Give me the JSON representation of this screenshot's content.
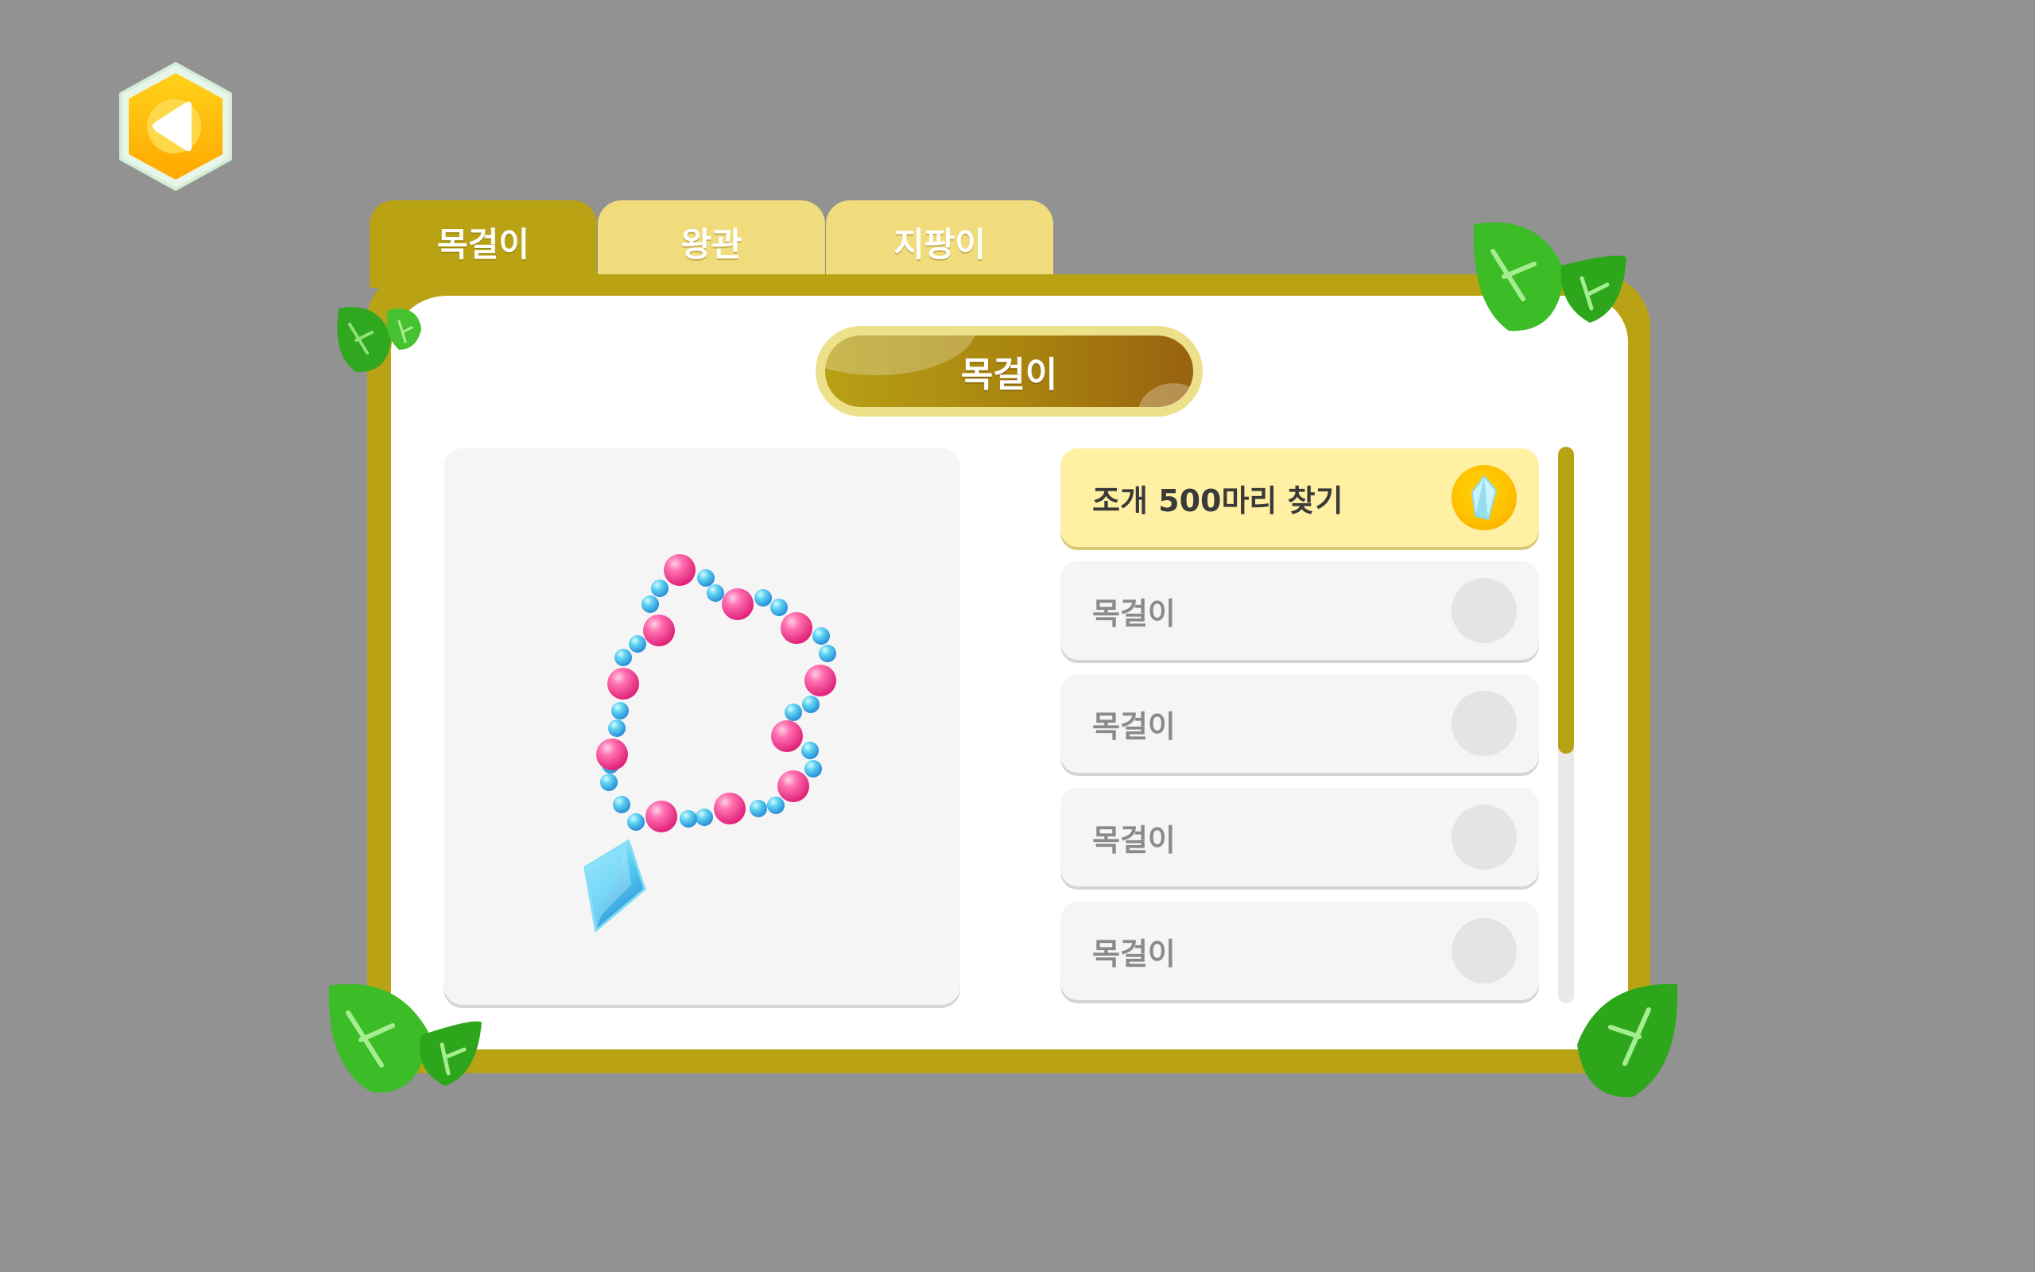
{
  "tabs": [
    {
      "label": "목걸이",
      "active": true
    },
    {
      "label": "왕관",
      "active": false
    },
    {
      "label": "지팡이",
      "active": false
    }
  ],
  "panel": {
    "title": "목걸이"
  },
  "items": [
    {
      "label": "조개 500마리 찾기",
      "active": true,
      "reward_icon": "crystal-icon"
    },
    {
      "label": "목걸이",
      "active": false
    },
    {
      "label": "목걸이",
      "active": false
    },
    {
      "label": "목걸이",
      "active": false
    },
    {
      "label": "목걸이",
      "active": false
    }
  ],
  "colors": {
    "background": "#929292",
    "frame": "#b9a315",
    "tab_inactive": "#f0dc7c",
    "item_active": "#fff0a3",
    "leaf": "#3fbf2a"
  },
  "icons": {
    "back": "back-arrow-icon",
    "preview": "necklace-icon",
    "decor": "leaf-icon"
  }
}
